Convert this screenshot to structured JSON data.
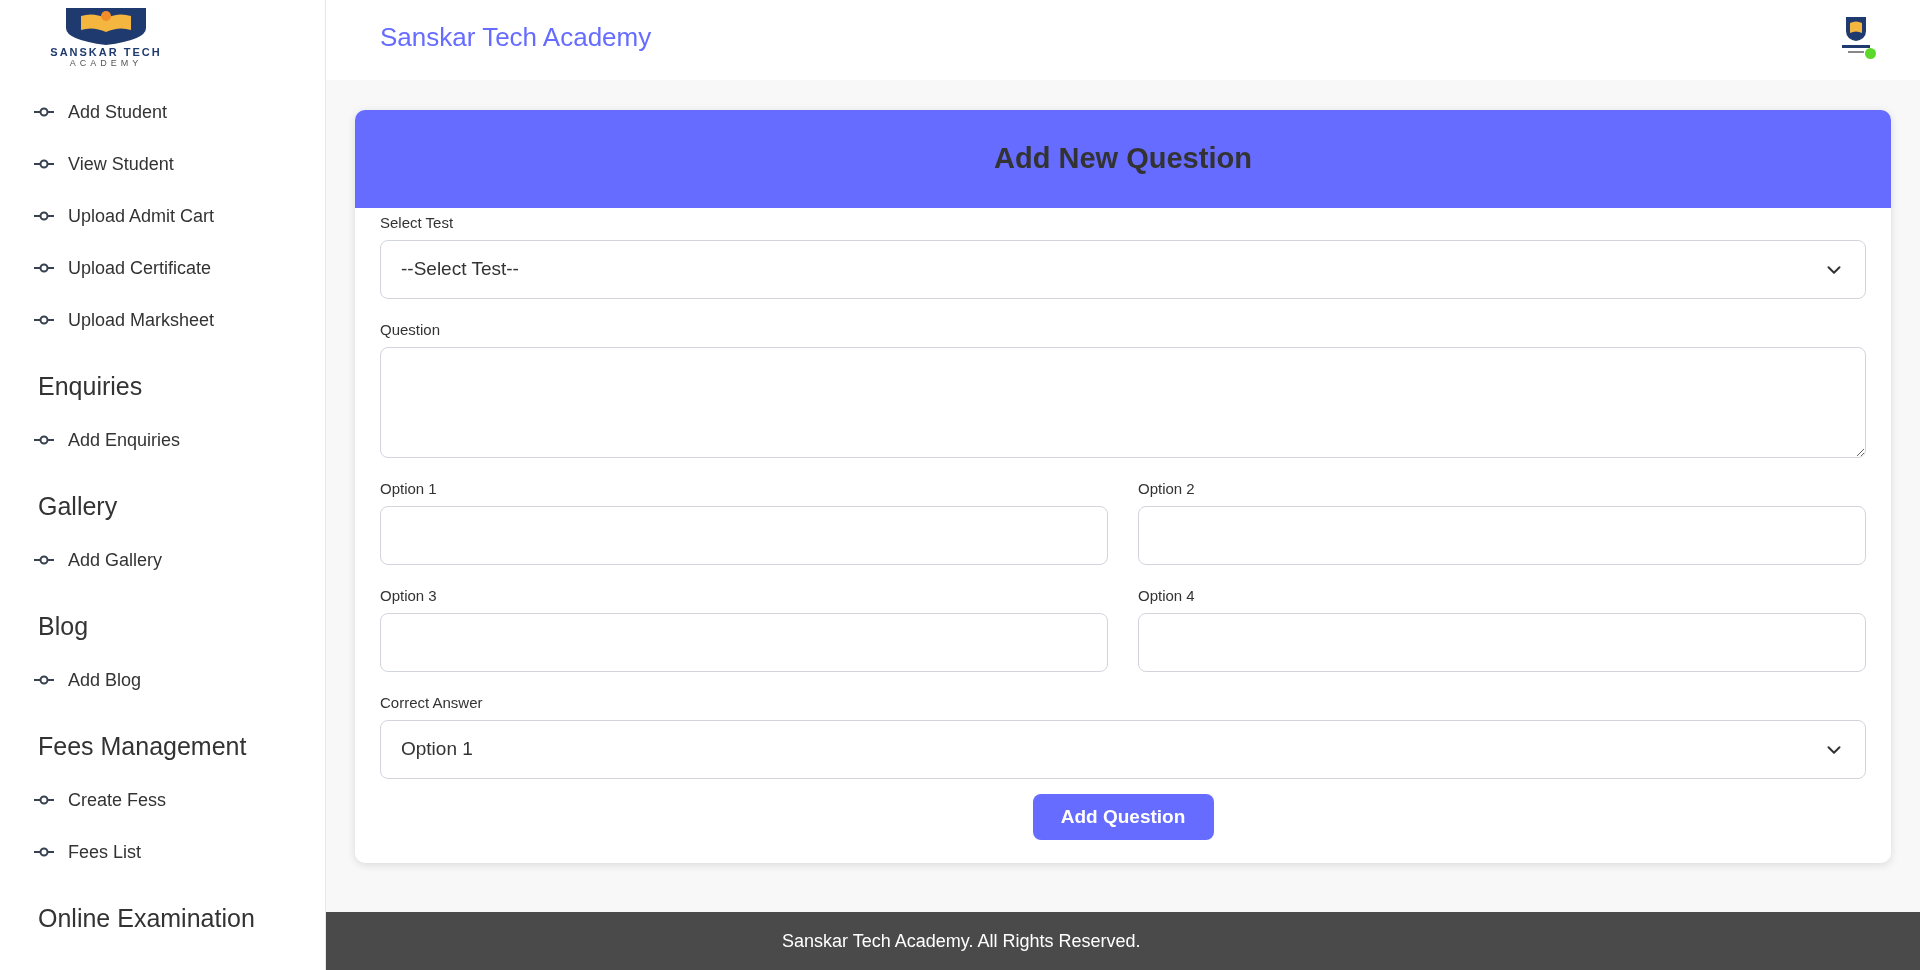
{
  "logo": {
    "name": "SANSKAR TECH",
    "subtitle": "ACADEMY"
  },
  "sidebar": {
    "sections": [
      {
        "items": [
          {
            "label": "Add Student"
          },
          {
            "label": "View Student"
          },
          {
            "label": "Upload Admit Cart"
          },
          {
            "label": "Upload Certificate"
          },
          {
            "label": "Upload Marksheet"
          }
        ]
      },
      {
        "title": "Enquiries",
        "items": [
          {
            "label": "Add Enquiries"
          }
        ]
      },
      {
        "title": "Gallery",
        "items": [
          {
            "label": "Add Gallery"
          }
        ]
      },
      {
        "title": "Blog",
        "items": [
          {
            "label": "Add Blog"
          }
        ]
      },
      {
        "title": "Fees Management",
        "items": [
          {
            "label": "Create Fess"
          },
          {
            "label": "Fees List"
          }
        ]
      },
      {
        "title": "Online Examination"
      }
    ]
  },
  "header": {
    "title": "Sanskar Tech Academy",
    "user_online": true
  },
  "form": {
    "title": "Add New Question",
    "fields": [
      {
        "kind": "select",
        "label": "Select Test",
        "value": "--Select Test--"
      },
      {
        "kind": "textarea",
        "label": "Question"
      },
      {
        "kind": "input",
        "label": "Option 1"
      },
      {
        "kind": "input",
        "label": "Option 2"
      },
      {
        "kind": "input",
        "label": "Option 3"
      },
      {
        "kind": "input",
        "label": "Option 4"
      },
      {
        "kind": "select",
        "label": "Correct Answer",
        "value": "Option 1"
      }
    ],
    "submit": "Add Question"
  },
  "footer": "Sanskar Tech Academy. All Rights Reserved."
}
